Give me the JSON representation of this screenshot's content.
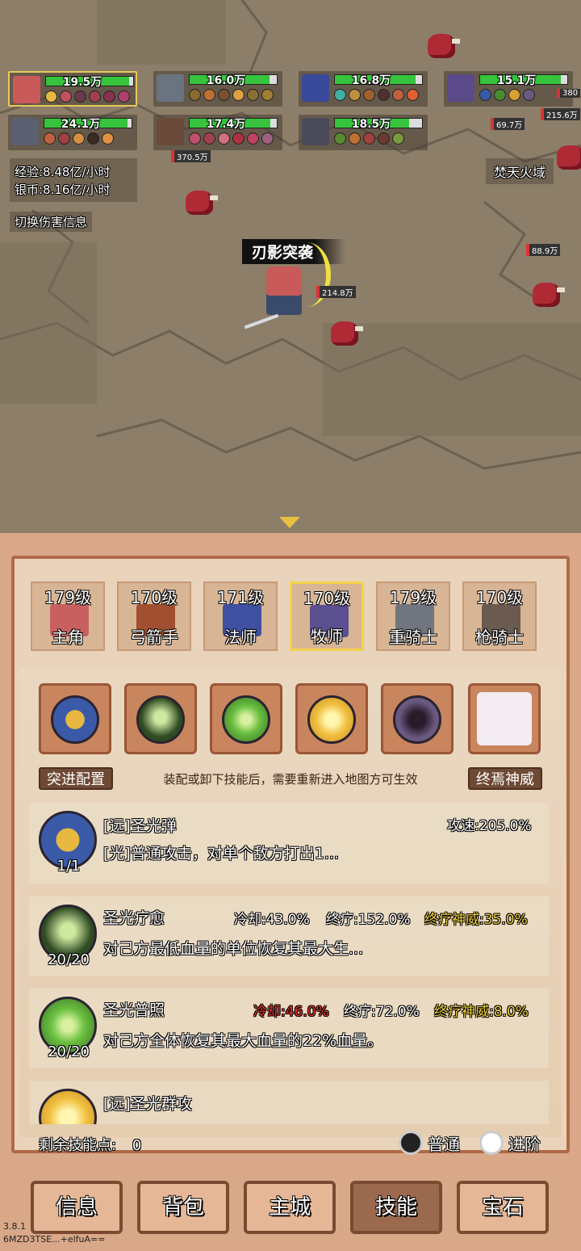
{
  "party": [
    {
      "hp": "19.5万",
      "fill": 0.95,
      "selected": true,
      "avatar": "#c85a5a"
    },
    {
      "hp": "16.0万",
      "fill": 0.92,
      "avatar": "#6a7380"
    },
    {
      "hp": "16.8万",
      "fill": 0.93,
      "avatar": "#3a4a9a"
    },
    {
      "hp": "15.1万",
      "fill": 0.93,
      "avatar": "#5a4a8a"
    },
    {
      "hp": "24.1万",
      "fill": 0.95,
      "avatar": "#5a6070"
    },
    {
      "hp": "17.4万",
      "fill": 0.93,
      "avatar": "#6a4a3a"
    },
    {
      "hp": "18.5万",
      "fill": 0.85,
      "avatar": "#4a4a5a"
    }
  ],
  "stats": {
    "exp": "经验:8.48亿/小时",
    "silver": "银币:8.16亿/小时",
    "toggle": "切换伤害信息"
  },
  "zone": "焚天火域",
  "floating": {
    "skill_name": "刃影突袭",
    "dmg1": "370.5万",
    "dmg2": "69.7万",
    "dmg3": "215.6万",
    "dmg4": "88.9万",
    "dmg5": "214.8万",
    "dmg6": "380"
  },
  "heroes": [
    {
      "level": "179级",
      "name": "主角",
      "color": "#c86060"
    },
    {
      "level": "170级",
      "name": "弓箭手",
      "color": "#a05030"
    },
    {
      "level": "171级",
      "name": "法师",
      "color": "#4050a0"
    },
    {
      "level": "170级",
      "name": "牧师",
      "color": "#5a5090",
      "selected": true
    },
    {
      "level": "179级",
      "name": "重骑士",
      "color": "#707580"
    },
    {
      "level": "170级",
      "name": "枪骑士",
      "color": "#6a5a50"
    }
  ],
  "slots": [
    {
      "icon": "holy-bolt-icon",
      "color": "#e8b840",
      "bg": "#3a5aa8"
    },
    {
      "icon": "holy-heal-icon",
      "color": "#cfe8a0",
      "bg": "#2e4a22"
    },
    {
      "icon": "holy-radiance-icon",
      "color": "#9fe060",
      "bg": "#4a8a30"
    },
    {
      "icon": "holy-burst-icon",
      "color": "#fff6b0",
      "bg": "#d8a030"
    },
    {
      "icon": "dark-tome-icon",
      "color": "#3a2a3a",
      "bg": "#6a5a80"
    }
  ],
  "labels": {
    "dash": "突进配置",
    "notice": "装配或卸下技能后，需要重新进入地图方可生效",
    "ultimate": "终焉神威",
    "points_label": "剩余技能点:",
    "points_value": "0",
    "normal": "普通",
    "advanced": "进阶"
  },
  "skills": [
    {
      "title": "[远]圣光弹",
      "desc": "[光]普通攻击，对单个敌方打出1...",
      "count": "1/1",
      "stat1": "攻速:205.0%"
    },
    {
      "title": "圣光疗愈",
      "desc": "对己方最低血量的单位恢复其最大生...",
      "count": "20/20",
      "stat1": "冷却:43.0%",
      "stat2": "终疗:152.0%",
      "stat3": "终疗神威:35.0%"
    },
    {
      "title": "圣光普照",
      "desc": "对己方全体恢复其最大血量的22%血量。",
      "count": "20/20",
      "stat1": "冷却:46.0%",
      "stat2": "终疗:72.0%",
      "stat3": "终疗神威:8.0%"
    },
    {
      "title": "[远]圣光群攻"
    }
  ],
  "nav": [
    "信息",
    "背包",
    "主城",
    "技能",
    "宝石"
  ],
  "footer": {
    "version": "3.8.1",
    "code": "6MZD3TSE...+elfuA=="
  },
  "colors": {
    "hp": "#35c43b",
    "red": "#e8302a",
    "gold": "#f0d040",
    "panel": "#d9a888"
  }
}
